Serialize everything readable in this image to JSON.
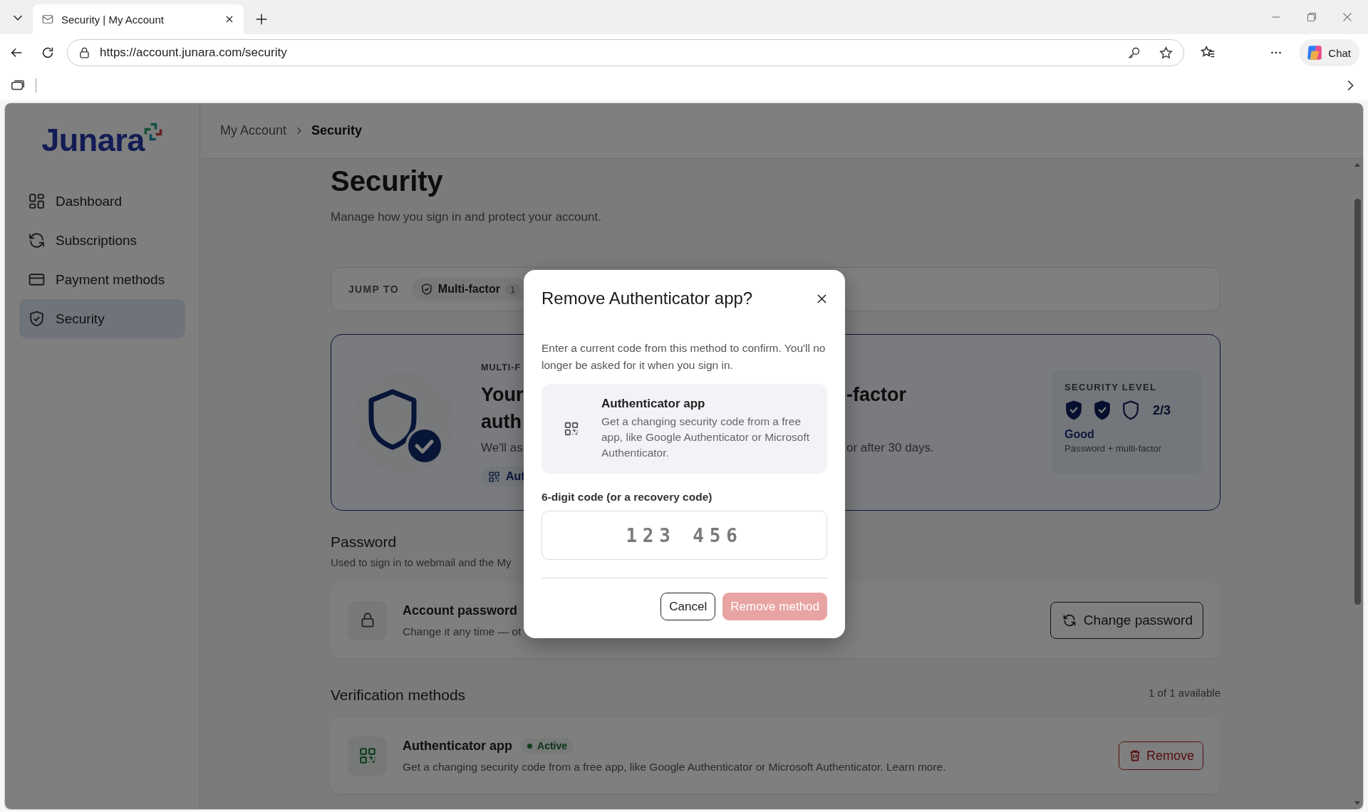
{
  "browser": {
    "tab_title": "Security | My Account",
    "url": "https://account.junara.com/security",
    "chat_label": "Chat"
  },
  "sidebar": {
    "logo": "Junara",
    "items": [
      {
        "label": "Dashboard",
        "selected": false
      },
      {
        "label": "Subscriptions",
        "selected": false
      },
      {
        "label": "Payment methods",
        "selected": false
      },
      {
        "label": "Security",
        "selected": true
      }
    ]
  },
  "breadcrumb": [
    {
      "label": "My Account",
      "current": false
    },
    {
      "label": "Security",
      "current": true
    }
  ],
  "page": {
    "title": "Security",
    "subtitle": "Manage how you sign in and protect your account."
  },
  "jump_to": {
    "label": "JUMP TO",
    "chips": [
      {
        "label": "Multi-factor",
        "count": "1"
      }
    ]
  },
  "mfa_card": {
    "eyebrow": "MULTI-F",
    "heading_start": "Your",
    "heading_end": "-factor",
    "heading_line_2": "auth",
    "description_start": "We'll as",
    "description_end": "or after 30 days.",
    "chip": "Aut",
    "security_level": {
      "label": "SECURITY LEVEL",
      "shields": [
        {
          "checked": true
        },
        {
          "checked": true
        },
        {
          "checked": false
        }
      ],
      "score": "2/3",
      "rating": "Good",
      "detail": "Password + multi-factor"
    }
  },
  "password": {
    "heading": "Password",
    "description": "Used to sign in to webmail and the My",
    "item_title": "Account password",
    "item_description": "Change it any time — ot",
    "button": "Change password"
  },
  "verification": {
    "heading": "Verification methods",
    "count": "1 of 1 available",
    "methods": [
      {
        "name": "Authenticator app",
        "status": "Active",
        "description": "Get a changing security code from a free app, like Google Authenticator or Microsoft Authenticator. Learn more.",
        "action": "Remove"
      }
    ]
  },
  "dialog": {
    "title": "Remove Authenticator app?",
    "message": "Enter a current code from this method to confirm. You'll no longer be asked for it when you sign in.",
    "method_name": "Authenticator app",
    "method_description": "Get a changing security code from a free app, like Google Authenticator or Microsoft Authenticator.",
    "code_label": "6-digit code (or a recovery code)",
    "code_placeholder": "123 456",
    "buttons": [
      {
        "label": "Cancel",
        "kind": "secondary",
        "disabled": false
      },
      {
        "label": "Remove method",
        "kind": "danger",
        "disabled": true
      }
    ]
  }
}
